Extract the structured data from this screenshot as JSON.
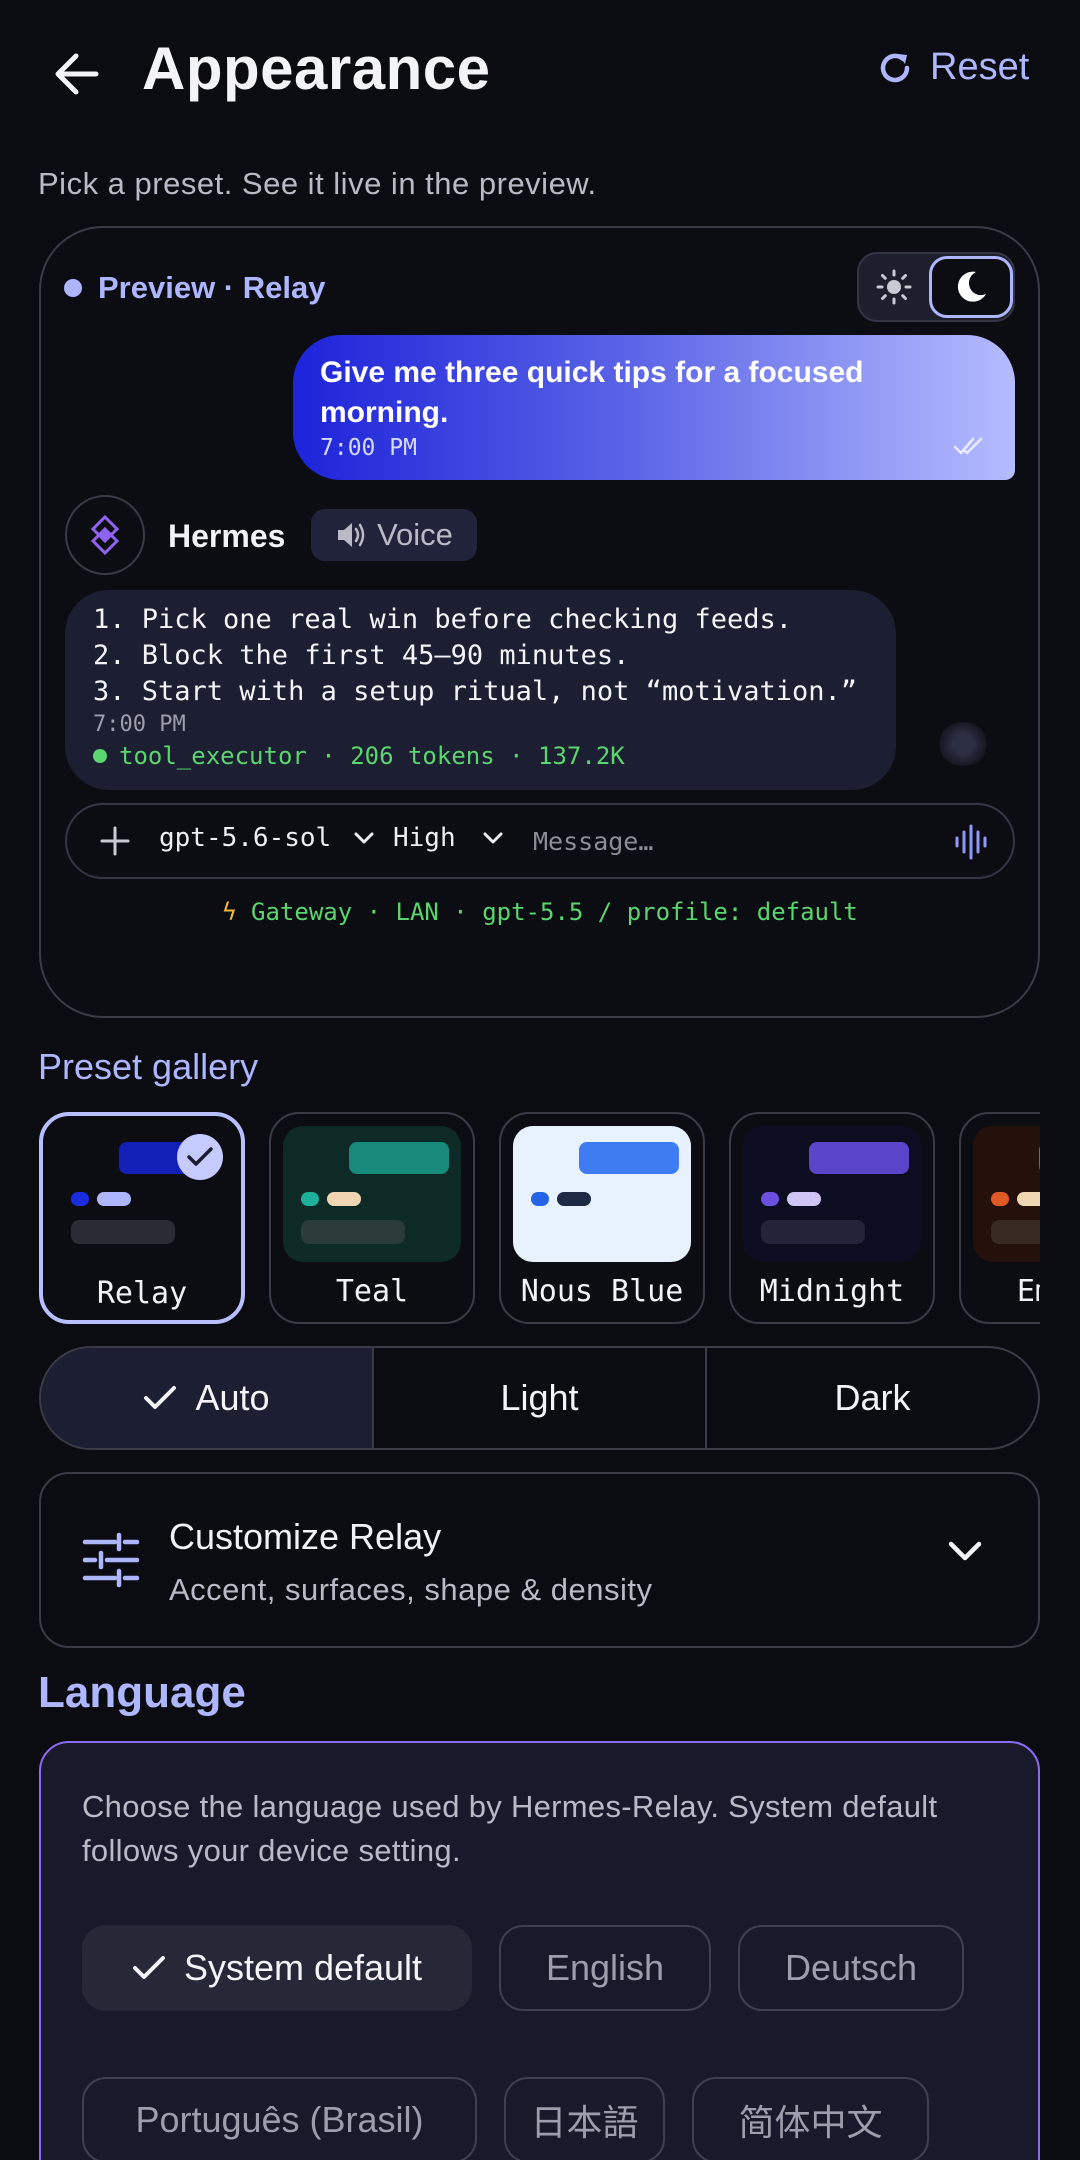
{
  "header": {
    "title": "Appearance",
    "reset_label": "Reset",
    "subtitle": "Pick a preset. See it live in the preview."
  },
  "preview": {
    "label": "Preview · Relay",
    "user_message": "Give me three quick tips for a focused morning.",
    "user_time": "7:00 PM",
    "agent_name": "Hermes",
    "voice_label": "Voice",
    "agent_lines": [
      "1. Pick one real win before checking feeds.",
      "2. Block the first 45–90 minutes.",
      "3. Start with a setup ritual, not “motivation.”"
    ],
    "agent_time": "7:00 PM",
    "agent_meta": "tool_executor · 206 tokens · 137.2K",
    "composer": {
      "model": "gpt-5.6-sol",
      "effort": "High",
      "placeholder": "Message…"
    },
    "gateway": "Gateway · LAN · gpt-5.5 / profile: default"
  },
  "gallery": {
    "title": "Preset gallery",
    "presets": [
      {
        "name": "Relay",
        "selected": true,
        "bg": "#0c0d13",
        "swatch": "#0c0d13",
        "accent": "#1320b8",
        "dot": "#1a2be0",
        "pill": "#aeb6ff",
        "line": "#2a2b33"
      },
      {
        "name": "Teal",
        "selected": false,
        "bg": "#0c0d13",
        "swatch": "#0d2a26",
        "accent": "#178a7c",
        "dot": "#1eb09a",
        "pill": "#f0d6b3",
        "line": "#2a3b38"
      },
      {
        "name": "Nous Blue",
        "selected": false,
        "bg": "#0c0d13",
        "swatch": "#e8f2ff",
        "accent": "#3e7cf2",
        "dot": "#2462e6",
        "pill": "#1f2a44",
        "line": "#e8f2ff"
      },
      {
        "name": "Midnight",
        "selected": false,
        "bg": "#0c0d13",
        "swatch": "#0d0d22",
        "accent": "#5a44c9",
        "dot": "#6a4fe0",
        "pill": "#cfc6f5",
        "line": "#23233a"
      },
      {
        "name": "Ember",
        "selected": false,
        "bg": "#0c0d13",
        "swatch": "#24110c",
        "accent": "#c94a24",
        "dot": "#e05a28",
        "pill": "#f0d6b3",
        "line": "#3a2a24"
      }
    ]
  },
  "theme_mode": {
    "options": [
      "Auto",
      "Light",
      "Dark"
    ],
    "selected": "Auto"
  },
  "customize": {
    "title": "Customize Relay",
    "subtitle": "Accent, surfaces, shape & density"
  },
  "language": {
    "title": "Language",
    "description": "Choose the language used by Hermes-Relay. System default follows your device setting.",
    "options": [
      "System default",
      "English",
      "Deutsch",
      "Português (Brasil)",
      "日本語",
      "简体中文"
    ],
    "selected": "System default"
  },
  "colors": {
    "accent": "#aeb6ff",
    "background": "#0b0c11",
    "success": "#5bd56e"
  }
}
